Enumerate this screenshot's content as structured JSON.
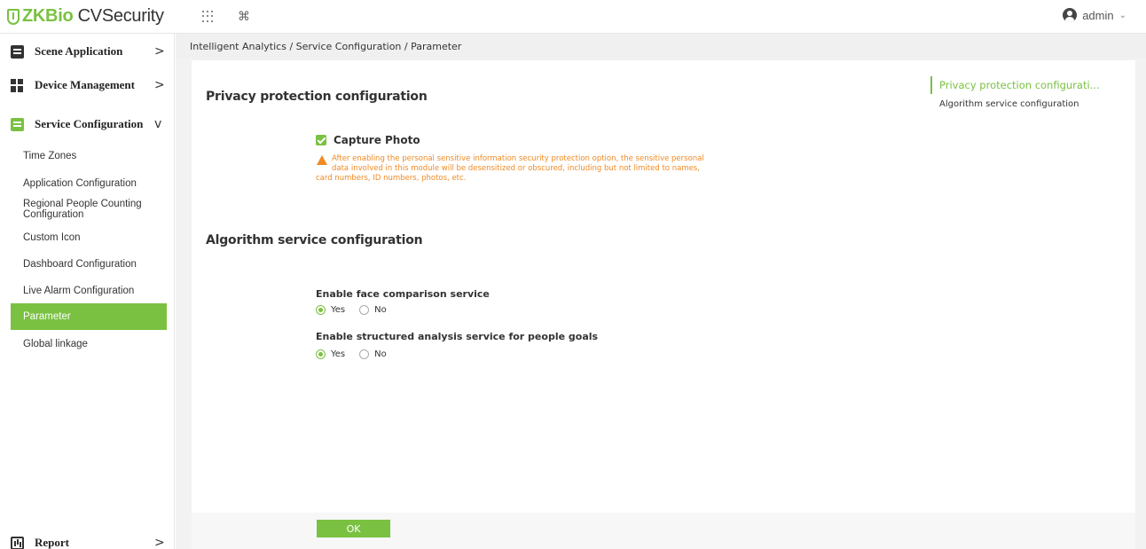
{
  "app": {
    "logo_zk": "ZKBio",
    "logo_rest": " CVSecurity",
    "user_name": "admin"
  },
  "sidebar": {
    "menus": [
      {
        "label": "Scene Application",
        "arrow": ">",
        "icon": "scene-icon"
      },
      {
        "label": "Device Management",
        "arrow": ">",
        "icon": "device-icon"
      },
      {
        "label": "Service Configuration",
        "arrow": "v",
        "icon": "service-icon"
      }
    ],
    "sub_items": [
      "Time Zones",
      "Application Configuration",
      "Regional People Counting Configuration",
      "Custom Icon",
      "Dashboard Configuration",
      "Live Alarm Configuration",
      "Parameter",
      "Global linkage"
    ],
    "active_sub": "Parameter",
    "report": {
      "label": "Report",
      "arrow": ">"
    },
    "collapse_glyph": "«"
  },
  "breadcrumb": "Intelligent Analytics / Service Configuration / Parameter",
  "privacy": {
    "title": "Privacy protection configuration",
    "capture_label": "Capture Photo",
    "capture_checked": true,
    "warning_lines": [
      "After enabling the personal sensitive information security protection option, the sensitive personal",
      "data involved in this module will be desensitized or obscured, including but not limited to names,",
      "card numbers, ID numbers, photos, etc."
    ]
  },
  "algorithm": {
    "title": "Algorithm service configuration",
    "face_label": "Enable face comparison service",
    "face_value": "Yes",
    "structured_label": "Enable structured analysis service for people goals",
    "structured_value": "Yes",
    "yes": "Yes",
    "no": "No"
  },
  "anchor_nav": {
    "active": "Privacy protection configurati...",
    "other": "Algorithm service configuration"
  },
  "ok_label": "OK",
  "colors": {
    "accent": "#7ac142",
    "warning": "#f08a24"
  }
}
